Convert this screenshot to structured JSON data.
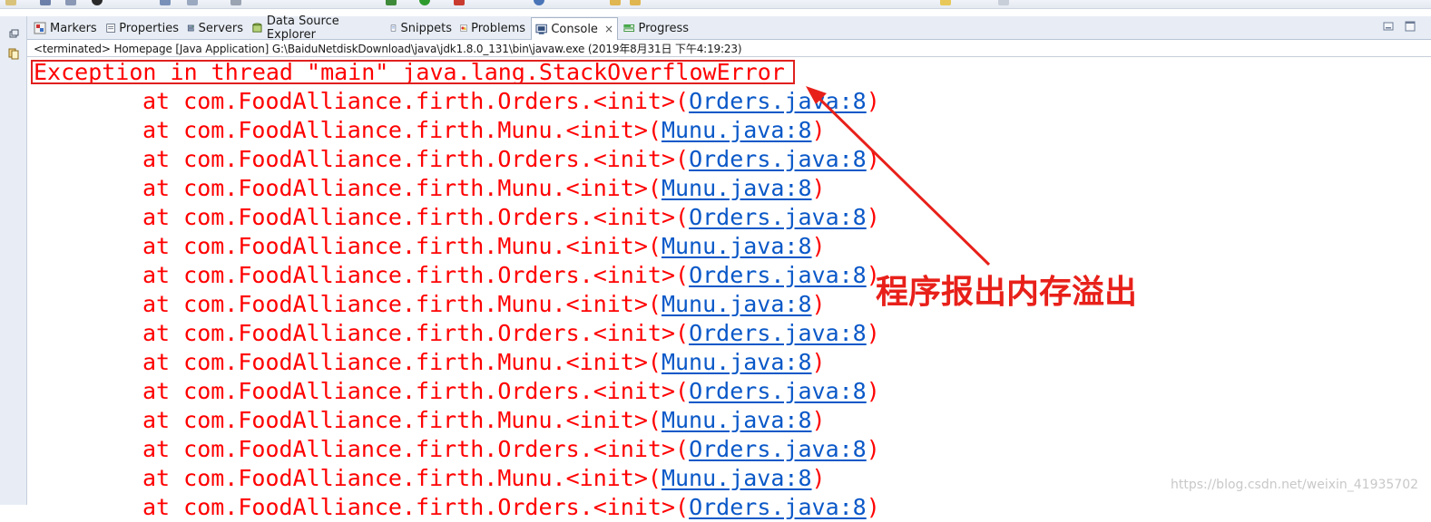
{
  "tabs": [
    {
      "label": "Markers",
      "icon": "markers-icon",
      "active": false
    },
    {
      "label": "Properties",
      "icon": "properties-icon",
      "active": false
    },
    {
      "label": "Servers",
      "icon": "servers-icon",
      "active": false
    },
    {
      "label": "Data Source Explorer",
      "icon": "data-source-icon",
      "active": false
    },
    {
      "label": "Snippets",
      "icon": "snippets-icon",
      "active": false
    },
    {
      "label": "Problems",
      "icon": "problems-icon",
      "active": false
    },
    {
      "label": "Console",
      "icon": "console-icon",
      "active": true,
      "close": "×"
    },
    {
      "label": "Progress",
      "icon": "progress-icon",
      "active": false
    }
  ],
  "status": "<terminated> Homepage [Java Application] G:\\BaiduNetdiskDownload\\java\\jdk1.8.0_131\\bin\\javaw.exe (2019年8月31日 下午4:19:23)",
  "console": {
    "exception": "Exception in thread \"main\" java.lang.StackOverflowError",
    "frames": [
      {
        "text": "at com.FoodAlliance.firth.Orders.<init>(",
        "link": "Orders.java:8",
        "close": ")"
      },
      {
        "text": "at com.FoodAlliance.firth.Munu.<init>(",
        "link": "Munu.java:8",
        "close": ")"
      },
      {
        "text": "at com.FoodAlliance.firth.Orders.<init>(",
        "link": "Orders.java:8",
        "close": ")"
      },
      {
        "text": "at com.FoodAlliance.firth.Munu.<init>(",
        "link": "Munu.java:8",
        "close": ")"
      },
      {
        "text": "at com.FoodAlliance.firth.Orders.<init>(",
        "link": "Orders.java:8",
        "close": ")"
      },
      {
        "text": "at com.FoodAlliance.firth.Munu.<init>(",
        "link": "Munu.java:8",
        "close": ")"
      },
      {
        "text": "at com.FoodAlliance.firth.Orders.<init>(",
        "link": "Orders.java:8",
        "close": ")"
      },
      {
        "text": "at com.FoodAlliance.firth.Munu.<init>(",
        "link": "Munu.java:8",
        "close": ")"
      },
      {
        "text": "at com.FoodAlliance.firth.Orders.<init>(",
        "link": "Orders.java:8",
        "close": ")"
      },
      {
        "text": "at com.FoodAlliance.firth.Munu.<init>(",
        "link": "Munu.java:8",
        "close": ")"
      },
      {
        "text": "at com.FoodAlliance.firth.Orders.<init>(",
        "link": "Orders.java:8",
        "close": ")"
      },
      {
        "text": "at com.FoodAlliance.firth.Munu.<init>(",
        "link": "Munu.java:8",
        "close": ")"
      },
      {
        "text": "at com.FoodAlliance.firth.Orders.<init>(",
        "link": "Orders.java:8",
        "close": ")"
      },
      {
        "text": "at com.FoodAlliance.firth.Munu.<init>(",
        "link": "Munu.java:8",
        "close": ")"
      },
      {
        "text": "at com.FoodAlliance.firth.Orders.<init>(",
        "link": "Orders.java:8",
        "close": ")"
      }
    ]
  },
  "annotation": "程序报出内存溢出",
  "watermark": "https://blog.csdn.net/weixin_41935702",
  "colors": {
    "error": "#ff0000",
    "link": "#0a58c8",
    "annotation": "#e8201a"
  }
}
